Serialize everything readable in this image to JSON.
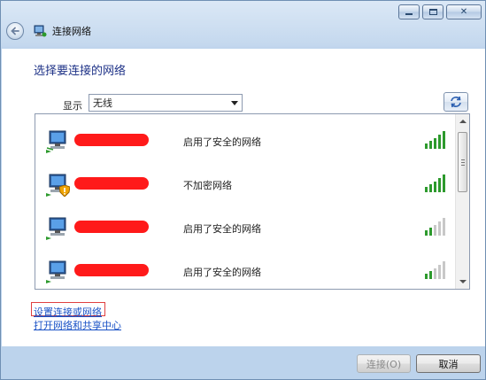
{
  "window": {
    "title": "连接网络",
    "caption_buttons": [
      "minimize",
      "maximize",
      "close"
    ],
    "close_glyph": "✕"
  },
  "heading": "选择要连接的网络",
  "filter": {
    "label": "显示",
    "selected": "无线"
  },
  "networks": [
    {
      "name": "",
      "security": "启用了安全的网络",
      "signal_bars": 5,
      "warning": false
    },
    {
      "name": "",
      "security": "不加密网络",
      "signal_bars": 5,
      "warning": true
    },
    {
      "name": "",
      "security": "启用了安全的网络",
      "signal_bars": 2,
      "warning": false
    },
    {
      "name": "",
      "security": "启用了安全的网络",
      "signal_bars": 2,
      "warning": false
    }
  ],
  "links": {
    "setup": "设置连接或网络",
    "center": "打开网络和共享中心"
  },
  "buttons": {
    "connect": "连接(O)",
    "cancel": "取消"
  },
  "colors": {
    "link": "#1a52c6",
    "heading": "#1e3287",
    "redaction": "#ff1a1a",
    "signal_active": "#2d9a2d",
    "signal_inactive": "#c8c8c8"
  },
  "icons": {
    "back": "back-arrow-icon",
    "title": "network-icon",
    "refresh": "refresh-icon",
    "network": "wireless-computer-icon",
    "warning": "shield-warning-icon",
    "signal": "signal-strength-icon"
  }
}
